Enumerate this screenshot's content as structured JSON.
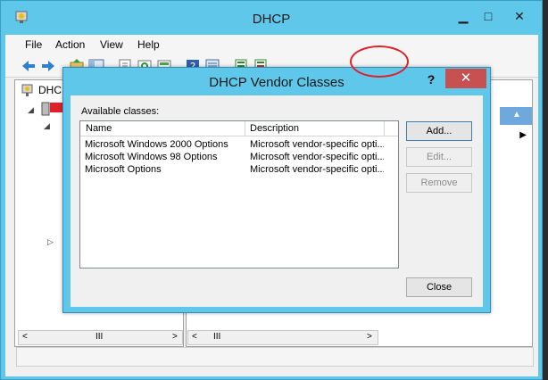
{
  "main_window": {
    "title": "DHCP",
    "caption": {
      "minimize": "▁",
      "maximize": "□",
      "close": "✕"
    },
    "menu": [
      "File",
      "Action",
      "View",
      "Help"
    ],
    "tree_root_label": "DHCP",
    "toolbar_icons": [
      "back-arrow-icon",
      "forward-arrow-icon",
      "up-folder-icon",
      "show-hide-tree-icon",
      "export-icon",
      "refresh-icon",
      "console-icon",
      "help-icon",
      "view-icon",
      "server-icon-a",
      "server-icon-b"
    ]
  },
  "dialog": {
    "title": "DHCP Vendor Classes",
    "help": "?",
    "close": "✕",
    "available_label": "Available classes:",
    "columns": [
      "Name",
      "Description"
    ],
    "rows": [
      {
        "name": "Microsoft Windows 2000 Options",
        "description": "Microsoft vendor-specific opti..."
      },
      {
        "name": "Microsoft Windows 98 Options",
        "description": "Microsoft vendor-specific opti..."
      },
      {
        "name": "Microsoft Options",
        "description": "Microsoft vendor-specific opti..."
      }
    ],
    "buttons": {
      "add": "Add...",
      "edit": "Edit...",
      "remove": "Remove",
      "close": "Close"
    }
  },
  "scrollbar": {
    "left": "<",
    "right": ">",
    "thumb": "III"
  },
  "colors": {
    "title_bar": "#5fc7ea",
    "close_red": "#c75050",
    "annotation_red": "#e0202a"
  }
}
